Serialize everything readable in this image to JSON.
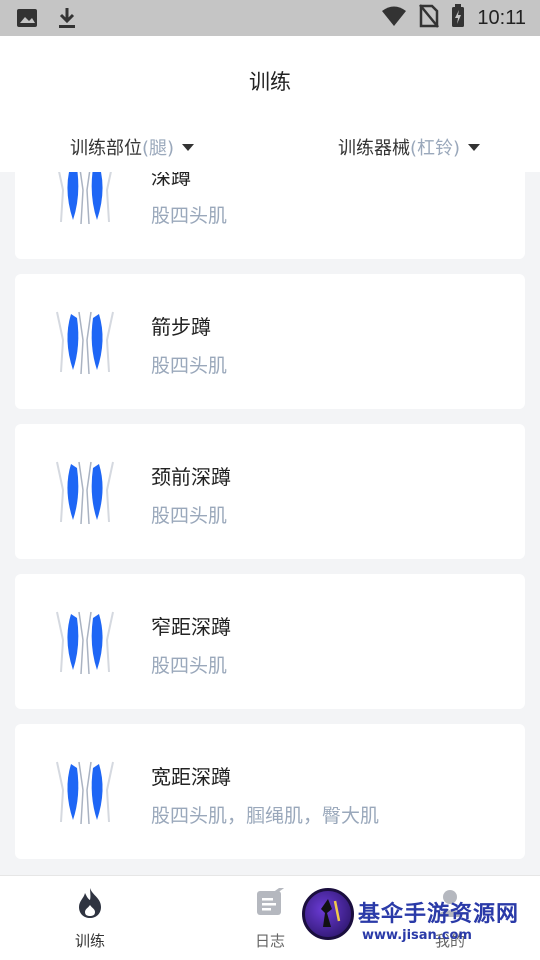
{
  "status_bar": {
    "time": "10:11"
  },
  "header": {
    "title": "训练",
    "filters": [
      {
        "label": "训练部位",
        "value": "(腿)"
      },
      {
        "label": "训练器械",
        "value": "(杠铃)"
      }
    ]
  },
  "exercises": [
    {
      "name": "深蹲",
      "muscles": "股四头肌"
    },
    {
      "name": "箭步蹲",
      "muscles": "股四头肌"
    },
    {
      "name": "颈前深蹲",
      "muscles": "股四头肌"
    },
    {
      "name": "窄距深蹲",
      "muscles": "股四头肌"
    },
    {
      "name": "宽距深蹲",
      "muscles": "股四头肌，腘绳肌，臀大肌"
    }
  ],
  "bottom_nav": [
    {
      "label": "训练",
      "icon": "flame-icon",
      "active": true
    },
    {
      "label": "日志",
      "icon": "log-icon",
      "active": false
    },
    {
      "label": "我的",
      "icon": "profile-icon",
      "active": false
    }
  ],
  "watermark": {
    "title": "基伞手游资源网",
    "url": "www.jisan.com"
  },
  "colors": {
    "accent": "#1e66f5",
    "muted_text": "#9aa8bb",
    "background": "#f3f4f6"
  }
}
